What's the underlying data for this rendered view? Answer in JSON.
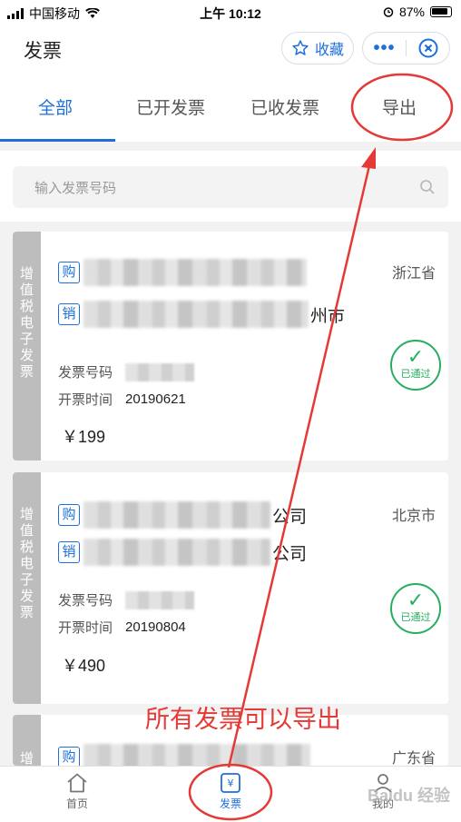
{
  "status_bar": {
    "carrier": "中国移动",
    "time": "上午 10:12",
    "battery": "87%"
  },
  "header": {
    "title": "发票",
    "favorite_label": "收藏",
    "more_label": "•••"
  },
  "tabs": [
    {
      "label": "全部",
      "active": true
    },
    {
      "label": "已开发票",
      "active": false
    },
    {
      "label": "已收发票",
      "active": false
    },
    {
      "label": "导出",
      "active": false
    }
  ],
  "search": {
    "placeholder": "输入发票号码"
  },
  "invoices": [
    {
      "type_label": "增值税电子发票",
      "buyer_tag": "购",
      "buyer_visible": "",
      "seller_tag": "销",
      "seller_visible": "州市",
      "province": "浙江省",
      "number_label": "发票号码",
      "date_label": "开票时间",
      "date": "20190621",
      "price": "￥199",
      "status": "已通过"
    },
    {
      "type_label": "增值税电子发票",
      "buyer_tag": "购",
      "buyer_visible": "公司",
      "seller_tag": "销",
      "seller_visible": "公司",
      "province": "北京市",
      "number_label": "发票号码",
      "date_label": "开票时间",
      "date": "20190804",
      "price": "￥490",
      "status": "已通过"
    },
    {
      "type_label": "增",
      "buyer_tag": "购",
      "buyer_visible": "",
      "province": "广东省"
    }
  ],
  "bottom_nav": [
    {
      "label": "首页",
      "icon": "home-icon",
      "active": false
    },
    {
      "label": "发票",
      "icon": "invoice-icon",
      "active": true
    },
    {
      "label": "我的",
      "icon": "profile-icon",
      "active": false
    }
  ],
  "annotation": {
    "caption": "所有发票可以导出",
    "color": "#e53935"
  },
  "watermark": "Baidu 经验",
  "colors": {
    "accent": "#1e6fd9",
    "success": "#27ae60",
    "annotation": "#e53935"
  }
}
